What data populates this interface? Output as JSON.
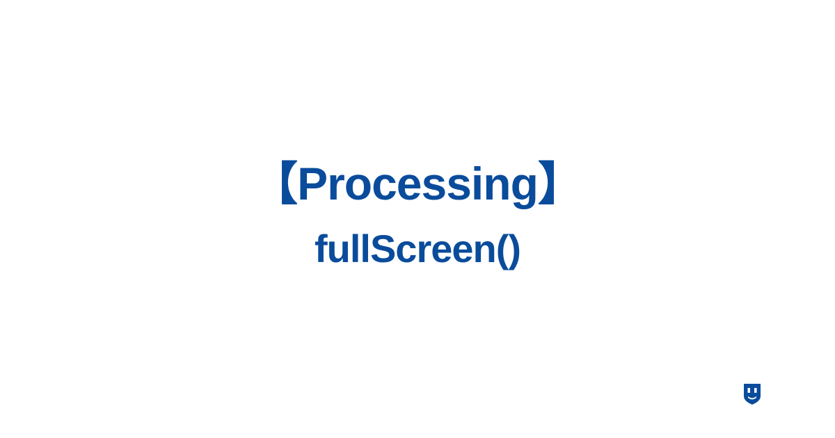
{
  "colors": {
    "text": "#0a4c9b",
    "background": "#ffffff"
  },
  "heading": {
    "title": "【Processing】",
    "subtitle": "fullScreen()"
  }
}
